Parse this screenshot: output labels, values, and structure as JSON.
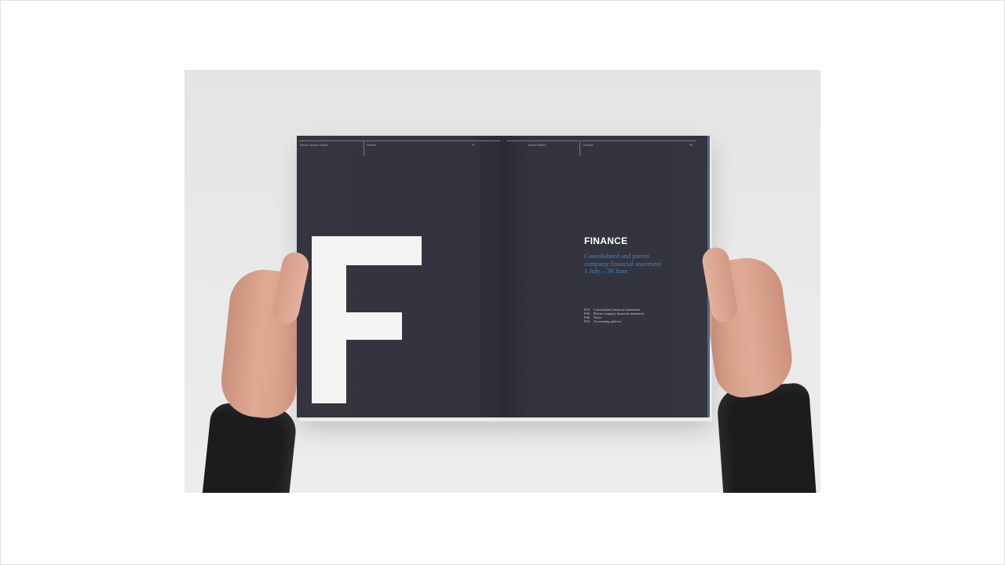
{
  "magazine": {
    "left_page": {
      "header_left": "Source: Annual Capital",
      "header_middle": "Finance",
      "header_page": "P4",
      "big_letter": "F"
    },
    "right_page": {
      "header_left": "Annual Report",
      "header_middle": "Finance",
      "header_page": "P5",
      "title": "FINANCE",
      "subtitle_line1": "Consolidated and parent",
      "subtitle_line2": "company financial statement",
      "subtitle_line3": "1 July – 30 June",
      "toc": [
        {
          "page": "P34",
          "label": "Consolidated financial statements"
        },
        {
          "page": "P40",
          "label": "Parent company financial statements"
        },
        {
          "page": "P46",
          "label": "Notes"
        },
        {
          "page": "P62",
          "label": "Accounting policies"
        }
      ]
    }
  },
  "colors": {
    "page_background": "#33333f",
    "accent_blue": "#3b87c9",
    "letter_white": "#f4f4f2",
    "backdrop": "#e6e6e6"
  }
}
